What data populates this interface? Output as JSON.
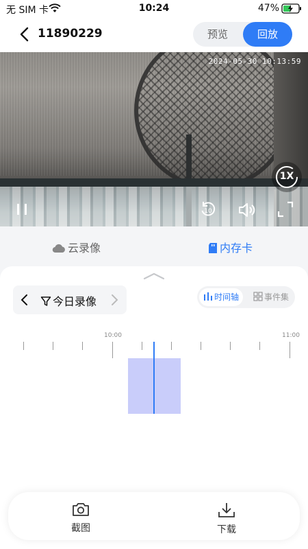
{
  "status_bar": {
    "carrier": "无 SIM 卡",
    "time": "10:24",
    "battery": "47%"
  },
  "header": {
    "title": "11890229",
    "mode_preview": "预览",
    "mode_playback": "回放",
    "active_mode": "回放"
  },
  "video": {
    "timestamp": "2024-05-30  10:13:59",
    "speed": "1X",
    "skip_seconds": "10"
  },
  "source_tabs": {
    "cloud": "云录像",
    "sd_card": "内存卡",
    "active": "内存卡"
  },
  "filter": {
    "label": "今日录像"
  },
  "view_toggle": {
    "timeline": "时间轴",
    "events": "事件集",
    "active": "时间轴"
  },
  "timeline": {
    "labels": [
      "10:00",
      "11:00"
    ]
  },
  "actions": {
    "snapshot": "截图",
    "download": "下载"
  },
  "colors": {
    "accent": "#2f7cf6",
    "recording_block": "#c9cdfa"
  }
}
